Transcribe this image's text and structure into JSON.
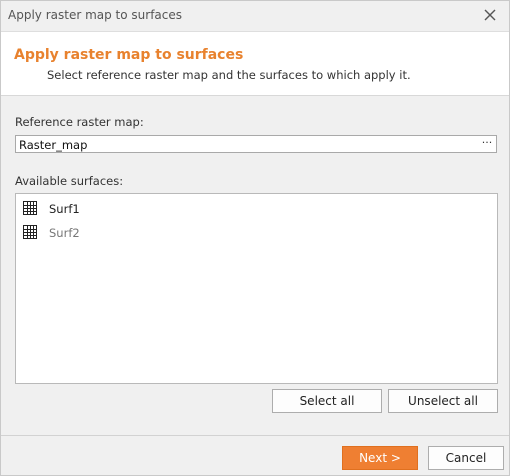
{
  "window": {
    "title": "Apply raster map to surfaces"
  },
  "header": {
    "title": "Apply raster map to surfaces",
    "subtitle": "Select reference raster map and the surfaces to which apply it."
  },
  "reference": {
    "label": "Reference raster map:",
    "value": "Raster_map",
    "browse_label": "···"
  },
  "surfaces": {
    "label": "Available surfaces:",
    "items": [
      {
        "label": "Surf1",
        "icon": "grid-icon",
        "color": "#222222"
      },
      {
        "label": "Surf2",
        "icon": "grid-icon",
        "color": "#777777"
      }
    ]
  },
  "buttons": {
    "select_all": "Select all",
    "unselect_all": "Unselect all",
    "next": "Next >",
    "cancel": "Cancel"
  },
  "colors": {
    "accent": "#e8822e",
    "primary_button": "#ef7f32"
  }
}
